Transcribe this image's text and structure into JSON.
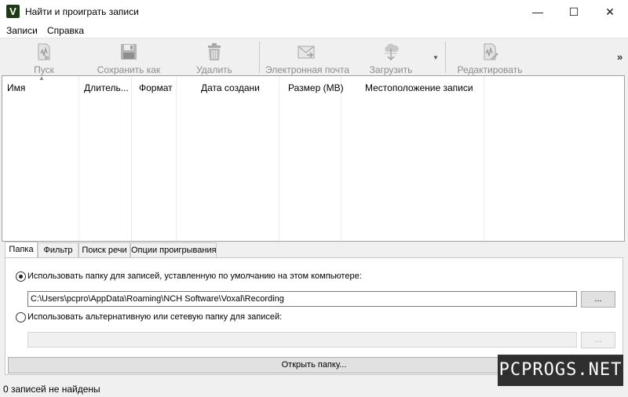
{
  "window": {
    "app_icon_letter": "V",
    "title": "Найти и проиграть записи",
    "minimize_glyph": "—",
    "maximize_glyph": "☐",
    "close_glyph": "✕"
  },
  "menu": [
    "Записи",
    "Справка"
  ],
  "toolbar": {
    "play": "Пуск",
    "save_as": "Сохранить как",
    "delete": "Удалить",
    "email": "Электронная почта",
    "upload": "Загрузить",
    "edit": "Редактировать",
    "dropdown_glyph": "▼",
    "more_glyph": "»"
  },
  "list": {
    "columns": [
      "Имя",
      "Длитель...",
      "Формат",
      "Дата создани",
      "Размер (MB)",
      "Местоположение записи"
    ],
    "rows": []
  },
  "tabs": [
    "Папка",
    "Фильтр",
    "Поиск речи",
    "Опции проигрывания"
  ],
  "folder_panel": {
    "default_option_label": "Использовать папку для записей, уставленную по умолчанию на этом компьютере:",
    "default_path": "C:\\Users\\pcpro\\AppData\\Roaming\\NCH Software\\Voxal\\Recording",
    "browse_label": "...",
    "alt_option_label": "Использовать альтернативную или сетевую папку для записей:",
    "alt_path": "",
    "alt_browse_label": "...",
    "open_folder_label": "Открыть папку..."
  },
  "status": {
    "text": "0 записей не найдены"
  },
  "watermark": "PCPROGS.NET"
}
